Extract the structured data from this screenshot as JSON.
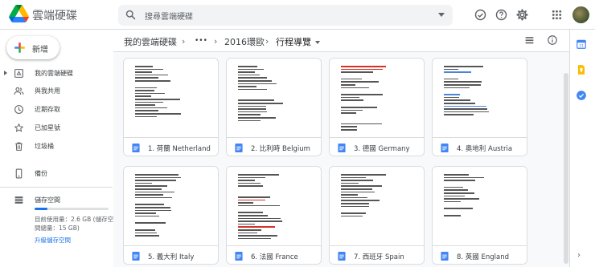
{
  "app": {
    "title": "雲端硬碟"
  },
  "search": {
    "placeholder": "搜尋雲端硬碟"
  },
  "new_button": {
    "label": "新增"
  },
  "sidebar": {
    "items": [
      {
        "label": "我的雲端硬碟",
        "icon": "drive-icon"
      },
      {
        "label": "與我共用",
        "icon": "shared-people-icon"
      },
      {
        "label": "近期存取",
        "icon": "clock-icon"
      },
      {
        "label": "已加星號",
        "icon": "star-icon"
      },
      {
        "label": "垃圾桶",
        "icon": "trash-icon"
      },
      {
        "label": "備份",
        "icon": "backup-phone-icon"
      }
    ],
    "storage": {
      "label": "儲存空間",
      "usage_line1": "目前使用量：2.6 GB (儲存空",
      "usage_line2": "間總量：15 GB)",
      "used_fraction": 0.17,
      "upgrade": "升級儲存空間"
    }
  },
  "breadcrumb": {
    "root": "我的雲端硬碟",
    "ellipsis": "•••",
    "folder": "2016環歐",
    "current": "行程導覽"
  },
  "files": [
    {
      "name": "1. 荷蘭 Netherland"
    },
    {
      "name": "2. 比利時 Belgium"
    },
    {
      "name": "3. 德國 Germany"
    },
    {
      "name": "4. 奧地利 Austria"
    },
    {
      "name": "5. 義大利 Italy"
    },
    {
      "name": "6. 法國 France"
    },
    {
      "name": "7. 西班牙 Spain"
    },
    {
      "name": "8. 英國 England"
    }
  ],
  "colors": {
    "accent": "#1a73e8",
    "doc_blue": "#4285f4",
    "keep_yellow": "#fbbc04",
    "tasks_blue": "#4285f4"
  }
}
